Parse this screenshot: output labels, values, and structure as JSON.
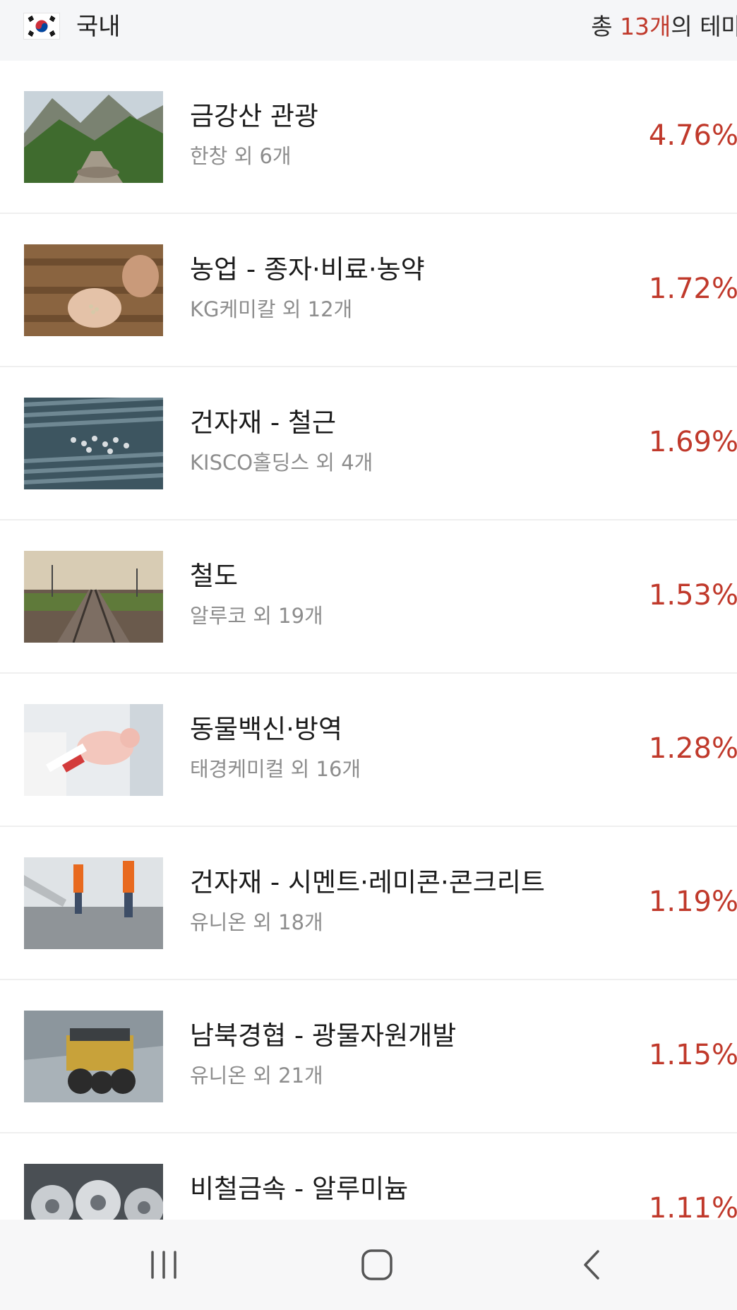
{
  "header": {
    "flag_icon": "korea-flag-icon",
    "region_label": "국내",
    "total_prefix": "총 ",
    "total_count": "13개",
    "total_suffix": "의 테마"
  },
  "themes": [
    {
      "title": "금강산 관광",
      "sub": "한창 외 6개",
      "pct": "4.76%",
      "image": "mountain-valley-photo"
    },
    {
      "title": "농업 - 종자·비료·농약",
      "sub": "KG케미칼 외 12개",
      "pct": "1.72%",
      "image": "seeds-in-hand-photo"
    },
    {
      "title": "건자재 - 철근",
      "sub": "KISCO홀딩스 외 4개",
      "pct": "1.69%",
      "image": "rebar-bundle-photo"
    },
    {
      "title": "철도",
      "sub": "알루코 외 19개",
      "pct": "1.53%",
      "image": "railway-track-photo"
    },
    {
      "title": "동물백신·방역",
      "sub": "태경케미컬 외 16개",
      "pct": "1.28%",
      "image": "piglet-vaccine-photo"
    },
    {
      "title": "건자재 - 시멘트·레미콘·콘크리트",
      "sub": "유니온 외 18개",
      "pct": "1.19%",
      "image": "concrete-workers-photo"
    },
    {
      "title": "남북경협 - 광물자원개발",
      "sub": "유니온 외 21개",
      "pct": "1.15%",
      "image": "mining-truck-photo"
    },
    {
      "title": "비철금속 - 알루미늄",
      "sub": "",
      "pct": "1.11%",
      "image": "aluminum-coils-photo"
    }
  ],
  "nav": {
    "recents_icon": "recent-apps-icon",
    "home_icon": "home-icon",
    "back_icon": "back-icon"
  },
  "colors": {
    "accent": "#c0392b",
    "header_bg": "#f5f6f8",
    "subtext": "#8d8d8d"
  }
}
